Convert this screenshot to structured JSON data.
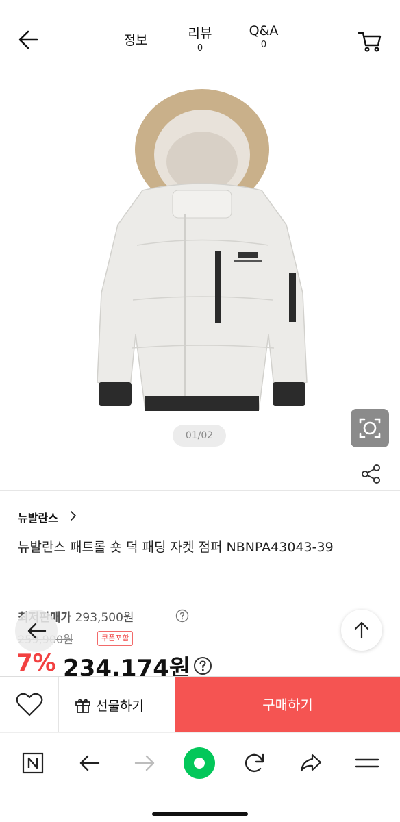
{
  "topnav": {
    "back_icon": "arrow-left-icon",
    "tabs": [
      {
        "label": "정보",
        "count": ""
      },
      {
        "label": "리뷰",
        "count": "0"
      },
      {
        "label": "Q&A",
        "count": "0"
      }
    ],
    "cart_icon": "cart-icon"
  },
  "hero": {
    "image": "white-padded-jacket-with-fur-hood",
    "pager": "01/02"
  },
  "product": {
    "brand": "뉴발란스",
    "name": "뉴발란스 패트롤 숏 덕 패딩 자켓 점퍼 NBNPA43043-39",
    "lowest_label": "최저판매가",
    "lowest_price": "293,500원",
    "original_price": "259,900원",
    "coupon_badge": "쿠폰포함",
    "discount": "7%",
    "price": "234,174원"
  },
  "buybar": {
    "gift_label": "선물하기",
    "buy_label": "구매하기"
  },
  "colors": {
    "accent": "#f55452",
    "discount": "#f24141",
    "naver_green": "#03c75a"
  }
}
